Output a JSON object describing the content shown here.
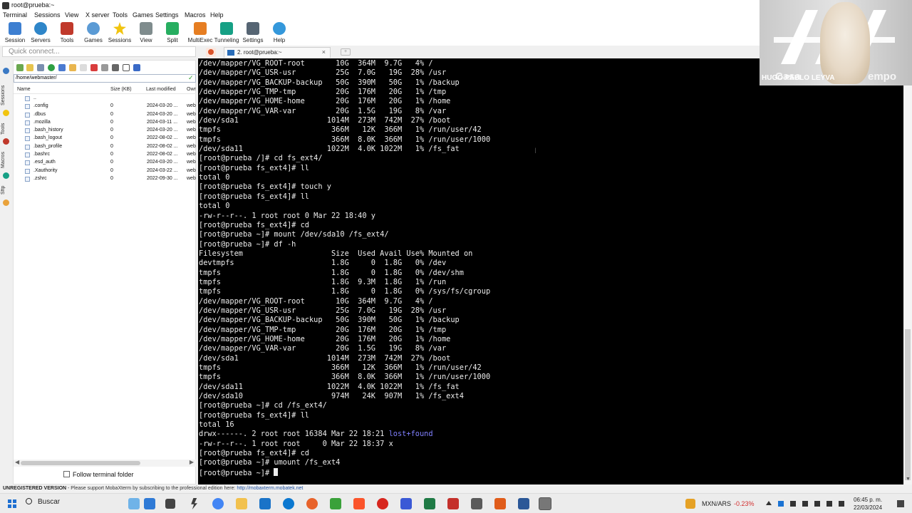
{
  "window": {
    "title": "root@prueba:~"
  },
  "menu": [
    "Terminal",
    "Sessions",
    "View",
    "X server",
    "Tools",
    "Games",
    "Settings",
    "Macros",
    "Help"
  ],
  "toolbar": [
    {
      "label": "Session",
      "icon": "session-icon",
      "color": "#3d7fd1"
    },
    {
      "label": "Servers",
      "icon": "servers-icon",
      "color": "#2f86c9"
    },
    {
      "label": "Tools",
      "icon": "tools-icon",
      "color": "#c0392b"
    },
    {
      "label": "Games",
      "icon": "games-icon",
      "color": "#5b9bd5"
    },
    {
      "label": "Sessions",
      "icon": "star-icon",
      "color": "#f1c40f"
    },
    {
      "label": "View",
      "icon": "view-icon",
      "color": "#7f8c8d"
    },
    {
      "label": "Split",
      "icon": "split-icon",
      "color": "#27ae60"
    },
    {
      "label": "MultiExec",
      "icon": "multiexec-icon",
      "color": "#e67e22"
    },
    {
      "label": "Tunneling",
      "icon": "tunneling-icon",
      "color": "#16a085"
    },
    {
      "label": "Settings",
      "icon": "settings-icon",
      "color": "#566573"
    },
    {
      "label": "Help",
      "icon": "help-icon",
      "color": "#3498db"
    }
  ],
  "quick_connect": {
    "placeholder": "Quick connect..."
  },
  "tabs": {
    "active": "2. root@prueba:~"
  },
  "side_tabs": [
    "Sessions",
    "Tools",
    "Macros",
    "Sftp"
  ],
  "sftp": {
    "path": "/home/webmaster/",
    "columns": [
      "Name",
      "Size (KB)",
      "Last modified",
      "Owr"
    ],
    "files": [
      {
        "name": "..",
        "size": "",
        "date": "",
        "owner": ""
      },
      {
        "name": ".config",
        "size": "0",
        "date": "2024-03-20 ...",
        "owner": "web"
      },
      {
        "name": ".dbus",
        "size": "0",
        "date": "2024-03-20 ...",
        "owner": "web"
      },
      {
        "name": ".mozilla",
        "size": "0",
        "date": "2024-03-11 ...",
        "owner": "web"
      },
      {
        "name": ".bash_history",
        "size": "0",
        "date": "2024-03-20 ...",
        "owner": "web"
      },
      {
        "name": ".bash_logout",
        "size": "0",
        "date": "2022-08-02 ...",
        "owner": "web"
      },
      {
        "name": ".bash_profile",
        "size": "0",
        "date": "2022-08-02 ...",
        "owner": "web"
      },
      {
        "name": ".bashrc",
        "size": "0",
        "date": "2022-08-02 ...",
        "owner": "web"
      },
      {
        "name": ".esd_auth",
        "size": "0",
        "date": "2024-03-20 ...",
        "owner": "web"
      },
      {
        "name": ".Xauthority",
        "size": "0",
        "date": "2024-03-22 ...",
        "owner": "web"
      },
      {
        "name": ".zshrc",
        "size": "0",
        "date": "2022-09-30 ...",
        "owner": "web"
      }
    ],
    "follow_label": "Follow terminal folder"
  },
  "terminal": {
    "lines": [
      "/dev/mapper/VG_ROOT-root       10G  364M  9.7G   4% /",
      "/dev/mapper/VG_USR-usr         25G  7.0G   19G  28% /usr",
      "/dev/mapper/VG_BACKUP-backup   50G  390M   50G   1% /backup",
      "/dev/mapper/VG_TMP-tmp         20G  176M   20G   1% /tmp",
      "/dev/mapper/VG_HOME-home       20G  176M   20G   1% /home",
      "/dev/mapper/VG_VAR-var         20G  1.5G   19G   8% /var",
      "/dev/sda1                    1014M  273M  742M  27% /boot",
      "tmpfs                         366M   12K  366M   1% /run/user/42",
      "tmpfs                         366M  8.0K  366M   1% /run/user/1000",
      "/dev/sda11                   1022M  4.0K 1022M   1% /fs_fat",
      "[root@prueba /]# cd fs_ext4/",
      "[root@prueba fs_ext4]# ll",
      "total 0",
      "[root@prueba fs_ext4]# touch y",
      "[root@prueba fs_ext4]# ll",
      "total 0",
      "-rw-r--r--. 1 root root 0 Mar 22 18:40 y",
      "[root@prueba fs_ext4]# cd",
      "[root@prueba ~]# mount /dev/sda10 /fs_ext4/",
      "[root@prueba ~]# df -h",
      "Filesystem                    Size  Used Avail Use% Mounted on",
      "devtmpfs                      1.8G     0  1.8G   0% /dev",
      "tmpfs                         1.8G     0  1.8G   0% /dev/shm",
      "tmpfs                         1.8G  9.3M  1.8G   1% /run",
      "tmpfs                         1.8G     0  1.8G   0% /sys/fs/cgroup",
      "/dev/mapper/VG_ROOT-root       10G  364M  9.7G   4% /",
      "/dev/mapper/VG_USR-usr         25G  7.0G   19G  28% /usr",
      "/dev/mapper/VG_BACKUP-backup   50G  390M   50G   1% /backup",
      "/dev/mapper/VG_TMP-tmp         20G  176M   20G   1% /tmp",
      "/dev/mapper/VG_HOME-home       20G  176M   20G   1% /home",
      "/dev/mapper/VG_VAR-var         20G  1.5G   19G   8% /var",
      "/dev/sda1                    1014M  273M  742M  27% /boot",
      "tmpfs                         366M   12K  366M   1% /run/user/42",
      "tmpfs                         366M  8.0K  366M   1% /run/user/1000",
      "/dev/sda11                   1022M  4.0K 1022M   1% /fs_fat",
      "/dev/sda10                    974M   24K  907M   1% /fs_ext4",
      "[root@prueba ~]# cd /fs_ext4/",
      "[root@prueba fs_ext4]# ll",
      "total 16",
      "drwx------. 2 root root 16384 Mar 22 18:21 ",
      "-rw-r--r--. 1 root root     0 Mar 22 18:37 x",
      "[root@prueba fs_ext4]# cd",
      "[root@prueba ~]# umount /fs_ext4",
      "[root@prueba ~]# "
    ],
    "dir_entry": "lost+found"
  },
  "statusbar": {
    "unregistered": "UNREGISTERED VERSION",
    "message": "  -  Please support MobaXterm by subscribing to the professional edition here: ",
    "link": "http://mobaxterm.mobatek.net"
  },
  "webcam": {
    "name": "HUGO PABLO LEYVA",
    "text_left": "Casa",
    "text_right": "empo"
  },
  "taskbar": {
    "search": "Buscar",
    "rate_label": "MXN/ARS",
    "rate_change": "-0.23%",
    "time": "06:45 p. m.",
    "date": "22/03/2024"
  }
}
